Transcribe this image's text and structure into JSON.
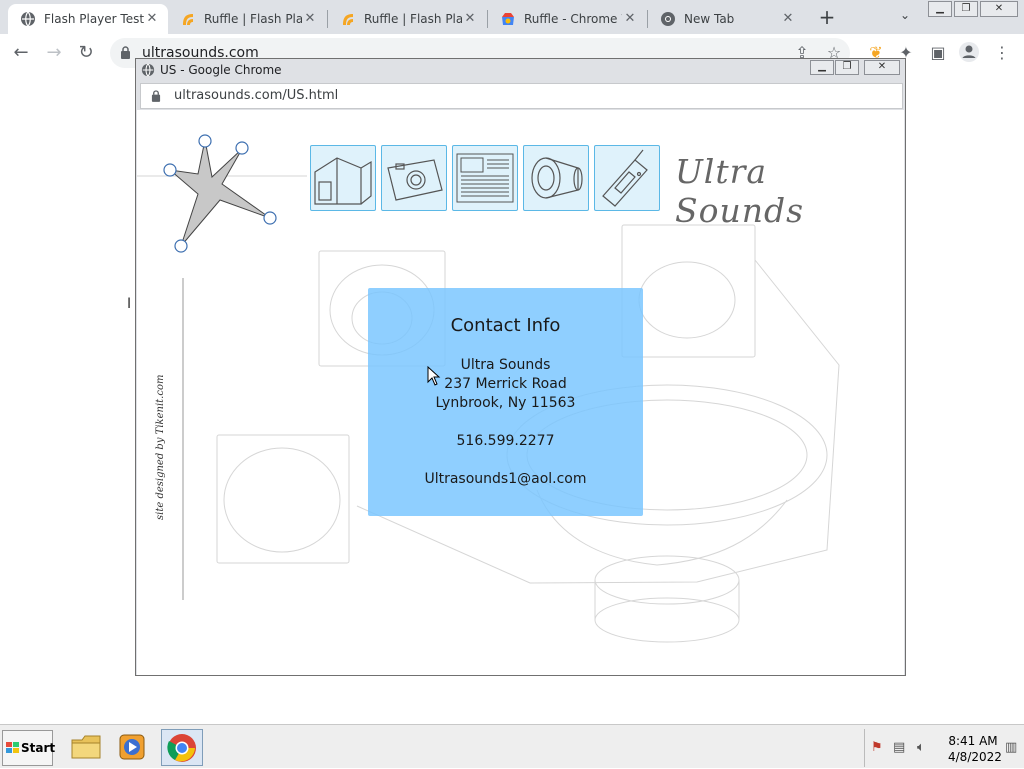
{
  "browser": {
    "tabs": [
      {
        "title": "Flash Player Test",
        "active": true
      },
      {
        "title": "Ruffle | Flash Play",
        "active": false
      },
      {
        "title": "Ruffle | Flash Play",
        "active": false
      },
      {
        "title": "Ruffle - Chrome W",
        "active": false
      },
      {
        "title": "New Tab",
        "active": false
      }
    ],
    "address": "ultrasounds.com"
  },
  "popup": {
    "title": "US - Google Chrome",
    "address": "ultrasounds.com/US.html"
  },
  "site": {
    "brand": "Ultra Sounds",
    "credit": "site designed by Tikenit.com",
    "nav_icons": [
      "house-icon",
      "camera-icon",
      "newspaper-icon",
      "speaker-icon",
      "cellphone-icon"
    ],
    "contact": {
      "heading": "Contact Info",
      "name": "Ultra Sounds",
      "street": "237 Merrick Road",
      "city": "Lynbrook, Ny 11563",
      "phone": "516.599.2277",
      "email": "Ultrasounds1@aol.com"
    }
  },
  "taskbar": {
    "start_label": "Start",
    "time": "8:41 AM",
    "date": "4/8/2022"
  },
  "colors": {
    "contact_box": "#76c4ff",
    "nav_border": "#5bb8e6",
    "nav_fill": "#dff2fb"
  }
}
